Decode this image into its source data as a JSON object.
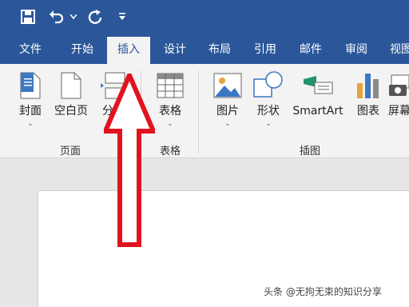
{
  "quick_access": {
    "icons": [
      "save-icon",
      "undo-icon",
      "undo-dropdown-icon",
      "redo-icon",
      "customize-toolbar-icon"
    ]
  },
  "tabs": [
    {
      "label": "文件"
    },
    {
      "label": "开始"
    },
    {
      "label": "插入",
      "active": true
    },
    {
      "label": "设计"
    },
    {
      "label": "布局"
    },
    {
      "label": "引用"
    },
    {
      "label": "邮件"
    },
    {
      "label": "审阅"
    },
    {
      "label": "视图"
    }
  ],
  "ribbon": {
    "groups": {
      "pages": "页面",
      "tables": "表格",
      "illustrations": "插图"
    },
    "buttons": {
      "cover": "封面",
      "blank_page": "空白页",
      "page_break": "分页",
      "table": "表格",
      "picture": "图片",
      "shapes": "形状",
      "smartart": "SmartArt",
      "chart": "图表",
      "screenshot": "屏幕"
    }
  },
  "watermark": "头条 @无拘无束的知识分享",
  "colors": {
    "title_bar": "#2b579a",
    "ribbon_bg": "#f3f3f3",
    "arrow_red": "#e0141e"
  }
}
